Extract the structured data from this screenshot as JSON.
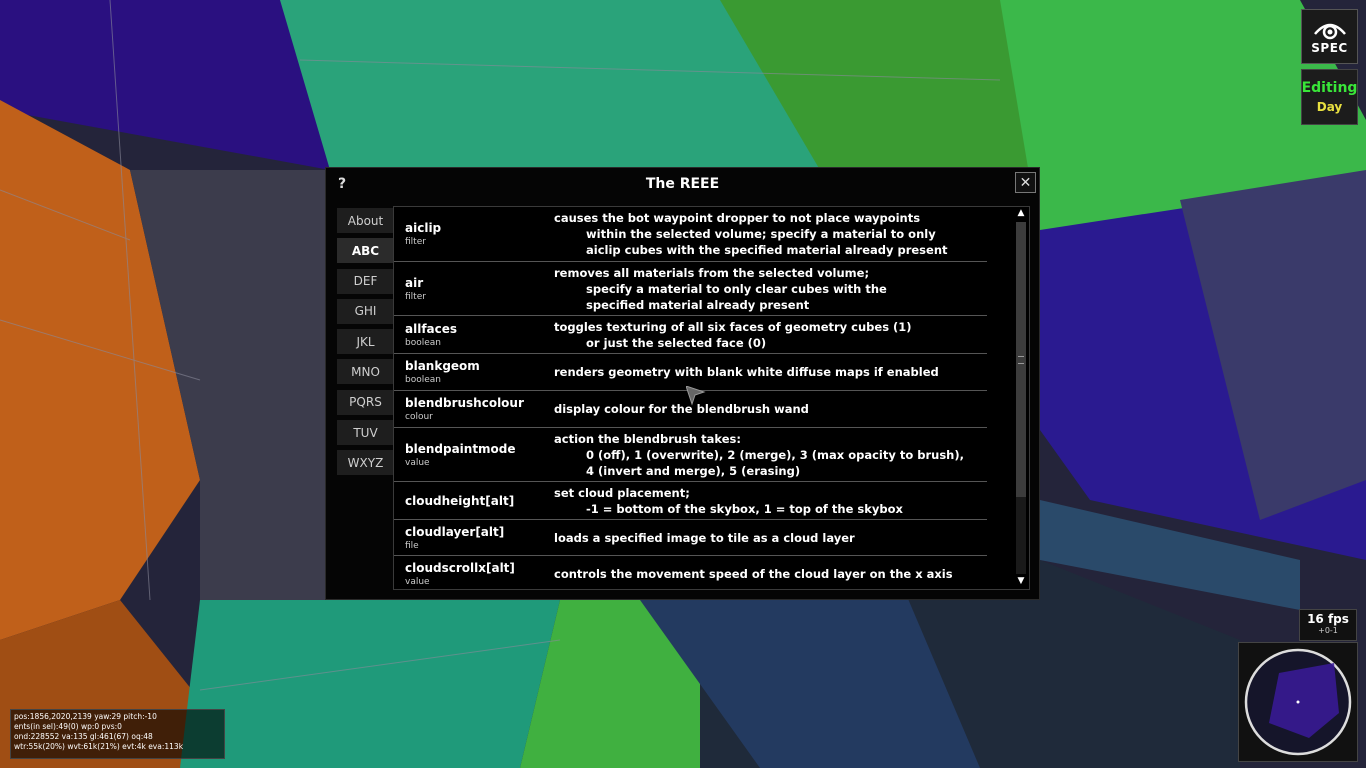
{
  "spec_button": {
    "label": "SPEC",
    "icon": "eye-icon"
  },
  "mode": {
    "label": "Editing",
    "sublabel": "Day"
  },
  "dialog": {
    "help_label": "?",
    "title": "The REEE",
    "close_label": "✕",
    "tabs": [
      "About",
      "ABC",
      "DEF",
      "GHI",
      "JKL",
      "MNO",
      "PQRS",
      "TUV",
      "WXYZ"
    ],
    "active_tab": "ABC",
    "entries": [
      {
        "name": "aiclip",
        "type": "filter",
        "desc": [
          "causes the bot waypoint dropper to not place waypoints",
          "within the selected volume; specify a material to only",
          "aiclip cubes with the specified material already present"
        ]
      },
      {
        "name": "air",
        "type": "filter",
        "desc": [
          "removes all materials from the selected volume;",
          "specify a material to only clear cubes with the",
          "specified material already present"
        ]
      },
      {
        "name": "allfaces",
        "type": "boolean",
        "desc": [
          "toggles texturing of all six faces of geometry cubes (1)",
          "or just the selected face (0)"
        ]
      },
      {
        "name": "blankgeom",
        "type": "boolean",
        "desc": [
          "renders geometry with blank white diffuse maps if enabled"
        ]
      },
      {
        "name": "blendbrushcolour",
        "type": "colour",
        "desc": [
          "display colour for the blendbrush wand"
        ]
      },
      {
        "name": "blendpaintmode",
        "type": "value",
        "desc": [
          "action the blendbrush takes:",
          "0 (off), 1 (overwrite), 2 (merge), 3 (max opacity to brush),",
          "4 (invert and merge), 5 (erasing)"
        ]
      },
      {
        "name": "cloudheight[alt]",
        "type": "",
        "desc": [
          "set cloud placement;",
          "-1 = bottom of the skybox, 1 = top of the skybox"
        ]
      },
      {
        "name": "cloudlayer[alt]",
        "type": "file",
        "desc": [
          "loads a specified image to tile as a cloud layer"
        ]
      },
      {
        "name": "cloudscrollx[alt]",
        "type": "value",
        "desc": [
          "controls the movement speed of the cloud layer on the x axis"
        ]
      }
    ]
  },
  "hud": {
    "lines": [
      "pos:1856,2020,2139 yaw:29 pitch:-10",
      "ents(in sel):49(0) wp:0 pvs:0",
      "ond:228552 va:135 gl:461(67) oq:48",
      "wtr:55k(20%) wvt:61k(21%) evt:4k eva:113k"
    ]
  },
  "fps": {
    "value": "16 fps",
    "sub": "+0-1"
  }
}
